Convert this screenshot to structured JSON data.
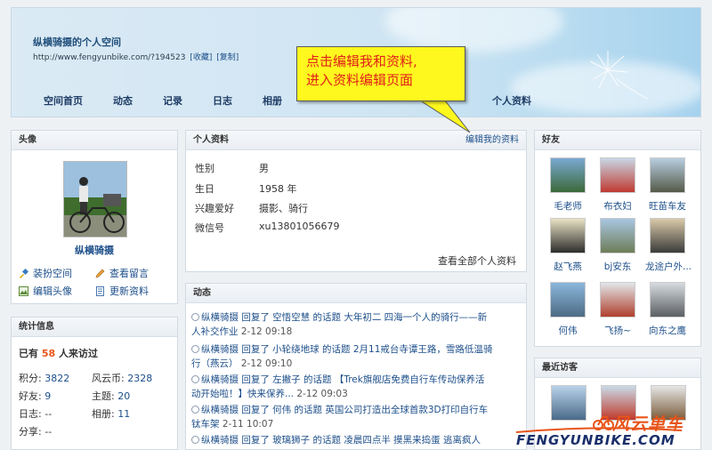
{
  "header": {
    "site_title": "纵横骑摄的个人空间",
    "url": "http://www.fengyunbike.com/?194523",
    "bookmark_label": "[收藏]",
    "copy_label": "[复制]",
    "nav": [
      "空间首页",
      "动态",
      "记录",
      "日志",
      "相册"
    ],
    "nav_profile": "个人资料"
  },
  "callout": {
    "line1": "点击编辑我和资料,",
    "line2": "进入资料编辑页面",
    "fill": "#fff81e",
    "text_color": "#e0221a"
  },
  "avatar_panel": {
    "title": "头像",
    "name": "纵横骑摄",
    "actions": [
      "装扮空间",
      "查看留言",
      "编辑头像",
      "更新资料"
    ]
  },
  "stats_panel": {
    "title": "统计信息",
    "visitors_prefix": "已有",
    "visitors_count": "58",
    "visitors_suffix": "人来访过",
    "points_label": "积分:",
    "points_value": "3822",
    "coins_label": "风云币:",
    "coins_value": "2328",
    "friends_label": "好友:",
    "friends_value": "9",
    "topics_label": "主题:",
    "topics_value": "20",
    "blog_label": "日志:",
    "blog_value": "--",
    "album_label": "相册:",
    "album_value": "11",
    "share_label": "分享:",
    "share_value": "--"
  },
  "profile_panel": {
    "title": "个人资料",
    "edit_link": "编辑我的资料",
    "fields": [
      {
        "label": "性别",
        "value": "男"
      },
      {
        "label": "生日",
        "value": "1958 年"
      },
      {
        "label": "兴趣爱好",
        "value": "摄影、骑行"
      },
      {
        "label": "微信号",
        "value": "xu13801056679"
      }
    ],
    "view_all": "查看全部个人资料"
  },
  "activity_panel": {
    "title": "动态",
    "items": [
      {
        "line1": "纵横骑摄 回复了 空悟空慧 的话题 大年初二 四海一个人的骑行——新",
        "line2": "人补交作业",
        "time": "2-12 09:18"
      },
      {
        "line1": "纵横骑摄 回复了 小轮绕地球 的话题 2月11戒台寺谭王路，雪路低温骑",
        "line2": "行（燕云）",
        "time": "2-12 09:10"
      },
      {
        "line1": "纵横骑摄 回复了 左撇子 的话题 【Trek旗舰店免费自行车传动保养活",
        "line2": "动开始啦！】快来保养...",
        "time": "2-12 09:03"
      },
      {
        "line1": "纵横骑摄 回复了 何伟 的话题 英国公司打造出全球首款3D打印自行车",
        "line2": "钛车架",
        "time": "2-11 10:07"
      },
      {
        "line1": "纵横骑摄 回复了 玻璃狮子 的话题 凌晨四点半 摸黑来捣蛋 逃离疯人",
        "line2": "",
        "time": ""
      }
    ]
  },
  "friends_panel": {
    "title": "好友",
    "friends": [
      "毛老师",
      "布衣妇",
      "旺苗车友",
      "赵飞燕",
      "bj安东",
      "龙途户外...",
      "何伟",
      "飞扬~",
      "向东之鹰"
    ]
  },
  "visitors_panel": {
    "title": "最近访客"
  },
  "watermark": {
    "cn": "风云单车",
    "en": "FENGYUNBIKE.COM"
  }
}
